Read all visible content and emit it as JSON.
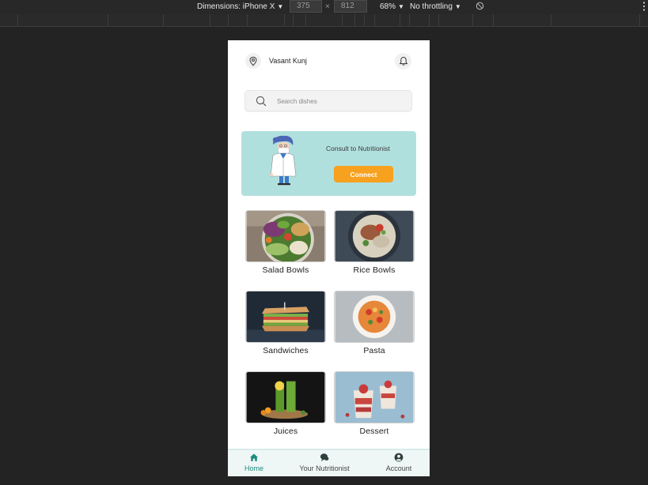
{
  "devtools": {
    "dimensions_label": "Dimensions: iPhone X",
    "width_value": "375",
    "times_sign": "×",
    "height_value": "812",
    "zoom_label": "68%",
    "throttling_label": "No throttling"
  },
  "header": {
    "location": "Vasant Kunj"
  },
  "search": {
    "placeholder": "Search dishes"
  },
  "banner": {
    "title": "Consult to Nutritionist",
    "button_label": "Connect"
  },
  "categories": [
    {
      "label": "Salad Bowls"
    },
    {
      "label": "Rice Bowls"
    },
    {
      "label": "Sandwiches"
    },
    {
      "label": "Pasta"
    },
    {
      "label": "Juices"
    },
    {
      "label": "Dessert"
    }
  ],
  "nav": {
    "items": [
      {
        "label": "Home",
        "icon": "home-icon",
        "active": true
      },
      {
        "label": "Your Nutritionist",
        "icon": "chat-icon",
        "active": false
      },
      {
        "label": "Account",
        "icon": "account-icon",
        "active": false
      }
    ]
  },
  "colors": {
    "banner_bg": "#b0e0de",
    "accent": "#f7a11f",
    "active_nav": "#1f8a7d"
  }
}
